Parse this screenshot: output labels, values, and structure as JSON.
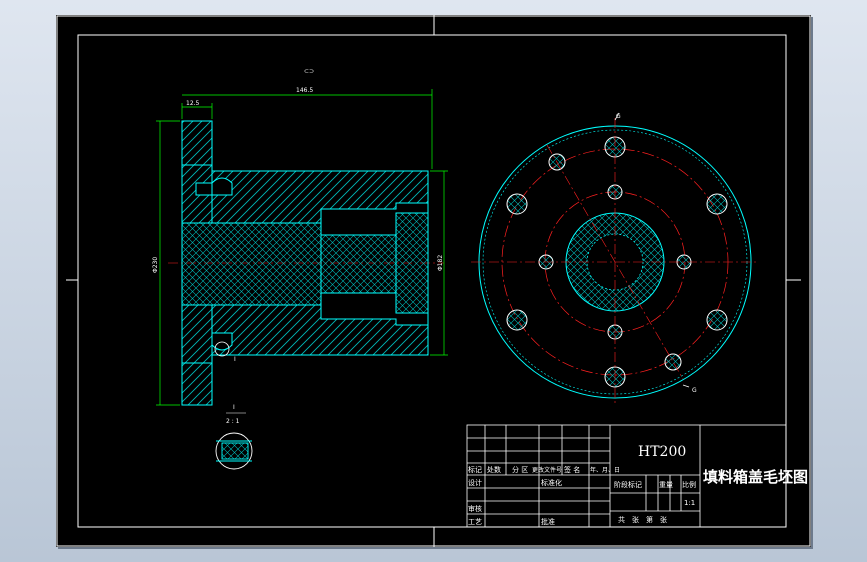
{
  "drawing": {
    "material": "HT200",
    "part_name": "填料箱盖毛坯图",
    "scale": "1:1",
    "detail_label": "I",
    "detail_scale": "2 : 1",
    "section_mark": "I",
    "rev_mark_a": "G",
    "rev_mark_b": "G"
  },
  "dimensions": {
    "flange_thickness": "12.5",
    "overall_length": "146.5",
    "flange_diameter": "Φ230",
    "body_diameter": "Φ182",
    "tolerance_symbol": "⊂⊃"
  },
  "title_block": {
    "col_mark": "标记",
    "col_count": "处数",
    "col_zone": "分 区",
    "col_doc": "更改文件号",
    "col_sign": "签 名",
    "col_date": "年、月、日",
    "row_design": "设计",
    "row_std": "标准化",
    "row_review": "审核",
    "row_process": "工艺",
    "row_approve": "批准",
    "stage_label": "阶段标记",
    "weight_label": "重量",
    "scale_label": "比例",
    "sheet_label": "共　张　第　张"
  },
  "colors": {
    "outline": "#00ffff",
    "hatch": "#00c8c8",
    "dimension": "#00ff00",
    "centerline": "#ff2020",
    "frame": "#ffffff"
  }
}
